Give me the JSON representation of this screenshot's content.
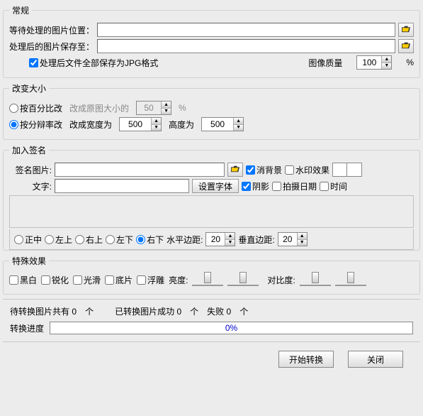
{
  "groups": {
    "general": "常规",
    "resize": "改变大小",
    "signature": "加入签名",
    "effects": "特殊效果"
  },
  "general": {
    "srcLabel": "等待处理的图片位置：",
    "dstLabel": "处理后的图片保存至：",
    "srcValue": "",
    "dstValue": "",
    "saveAsJpg": "处理后文件全部保存为JPG格式",
    "qualityLabel": "图像质量",
    "qualityValue": "100",
    "qualityUnit": "%"
  },
  "resize": {
    "byPercent": "按百分比改",
    "percentHint": "改成原图大小的",
    "percentValue": "50",
    "byResolution": "按分辩率改",
    "widthLabel": "改成宽度为",
    "heightLabel": "高度为",
    "widthValue": "500",
    "heightValue": "500"
  },
  "sig": {
    "picLabel": "签名图片:",
    "picValue": "",
    "removeBg": "消背景",
    "watermark": "水印效果",
    "textLabel": "文字:",
    "textValue": "",
    "fontBtn": "设置字体",
    "shadow": "阴影",
    "shootDate": "拍摄日期",
    "time": "时间",
    "posCenter": "正中",
    "posTL": "左上",
    "posTR": "右上",
    "posBL": "左下",
    "posBR": "右下",
    "hMarginLabel": "水平边距:",
    "vMarginLabel": "垂直边距:",
    "hMargin": "20",
    "vMargin": "20"
  },
  "fx": {
    "bw": "黑白",
    "sharpen": "锐化",
    "smooth": "光滑",
    "negative": "底片",
    "emboss": "浮雕",
    "brightness": "亮度:",
    "contrast": "对比度:"
  },
  "status": {
    "pendingLabel": "待转换图片共有",
    "pendingCount": "0",
    "unit": "个",
    "doneLabel": "已转换图片成功",
    "doneCount": "0",
    "failLabel": "失败",
    "failCount": "0",
    "progressLabel": "转换进度",
    "progressText": "0%"
  },
  "buttons": {
    "start": "开始转换",
    "close": "关闭"
  },
  "percentSign": "%"
}
